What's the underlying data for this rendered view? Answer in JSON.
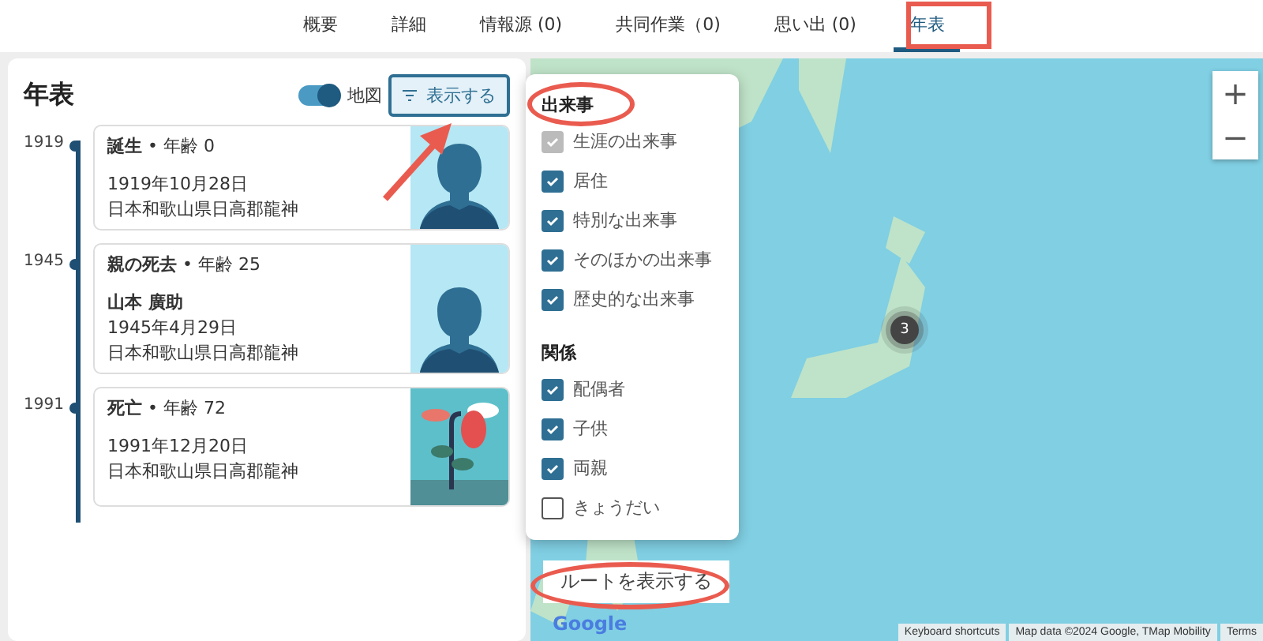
{
  "tabs": [
    {
      "label": "概要",
      "selected": false
    },
    {
      "label": "詳細",
      "selected": false
    },
    {
      "label": "情報源 (0)",
      "selected": false
    },
    {
      "label": "共同作業（0)",
      "selected": false
    },
    {
      "label": "思い出 (0)",
      "selected": false
    },
    {
      "label": "年表",
      "selected": true
    }
  ],
  "timeline": {
    "title": "年表",
    "map_toggle": {
      "label": "地図",
      "on": true
    },
    "filter_button": "表示する",
    "events": [
      {
        "kind": "person",
        "year": "1919",
        "title": "**誕生** • 年齢 0",
        "date": "1919年10月28日",
        "place": "日本和歌山県日高郡龍神"
      },
      {
        "kind": "person",
        "year": "1945",
        "title": "**親の死去** • 年齢 25",
        "person": "山本 廣助",
        "date": "1945年4月29日",
        "place": "日本和歌山県日高郡龍神"
      },
      {
        "kind": "flower",
        "year": "1991",
        "title": "**死亡** • 年齢 72",
        "date": "1991年12月20日",
        "place": "日本和歌山県日高郡龍神"
      }
    ]
  },
  "filter_menu": {
    "sections": [
      {
        "heading": "出来事",
        "items": [
          {
            "label": "生涯の出来事",
            "checked": true,
            "disabled": true
          },
          {
            "label": "居住",
            "checked": true,
            "disabled": false
          },
          {
            "label": "特別な出来事",
            "checked": true,
            "disabled": false
          },
          {
            "label": "そのほかの出来事",
            "checked": true,
            "disabled": false
          },
          {
            "label": "歴史的な出来事",
            "checked": true,
            "disabled": false
          }
        ]
      },
      {
        "heading": "関係",
        "items": [
          {
            "label": "配偶者",
            "checked": true,
            "disabled": false
          },
          {
            "label": "子供",
            "checked": true,
            "disabled": false
          },
          {
            "label": "両親",
            "checked": true,
            "disabled": false
          },
          {
            "label": "きょうだい",
            "checked": false,
            "disabled": false
          }
        ]
      }
    ]
  },
  "map": {
    "zoom_in": "+",
    "zoom_out": "−",
    "cluster_count": "3",
    "route_button": "ルートを表示する",
    "logo": "Google",
    "attribution": [
      "Keyboard shortcuts",
      "Map data ©2024 Google, TMap Mobility",
      "Terms"
    ]
  }
}
